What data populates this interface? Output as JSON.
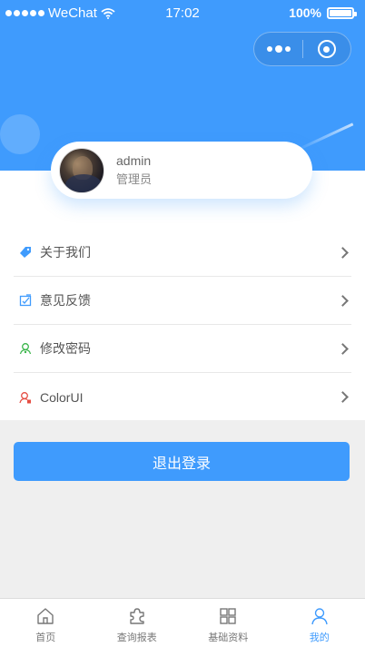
{
  "status_bar": {
    "carrier": "WeChat",
    "time": "17:02",
    "battery": "100%"
  },
  "capsule": {
    "more_icon": "more-dots-icon",
    "close_icon": "target-close-icon"
  },
  "user": {
    "name": "admin",
    "role": "管理员"
  },
  "menu": [
    {
      "label": "关于我们",
      "icon": "tag-icon",
      "color": "#3f9bfd"
    },
    {
      "label": "意见反馈",
      "icon": "feedback-icon",
      "color": "#3f9bfd"
    },
    {
      "label": "修改密码",
      "icon": "user-key-icon",
      "color": "#39b54a"
    },
    {
      "label": "ColorUI",
      "icon": "user-badge-icon",
      "color": "#e54d42"
    }
  ],
  "logout_label": "退出登录",
  "tabbar": [
    {
      "label": "首页",
      "icon": "home-icon",
      "active": false
    },
    {
      "label": "查询报表",
      "icon": "puzzle-icon",
      "active": false
    },
    {
      "label": "基础资料",
      "icon": "grid-icon",
      "active": false
    },
    {
      "label": "我的",
      "icon": "user-icon",
      "active": true
    }
  ],
  "colors": {
    "primary": "#3f9bfd",
    "background": "#efefef"
  }
}
